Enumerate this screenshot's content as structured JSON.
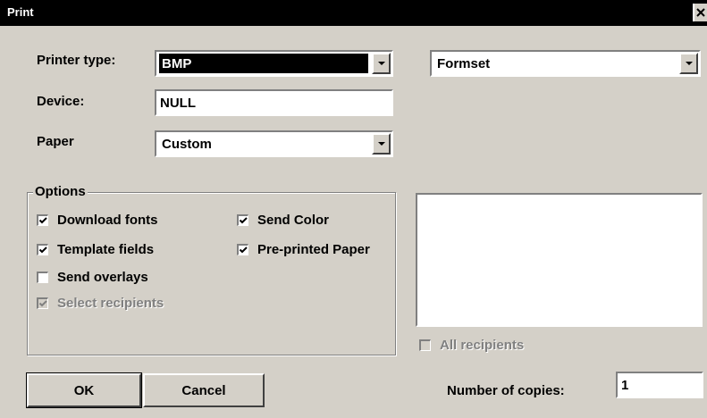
{
  "window": {
    "title": "Print"
  },
  "printer_type": {
    "label": "Printer type:",
    "value": "BMP"
  },
  "formset": {
    "value": "Formset"
  },
  "device": {
    "label": "Device:",
    "value": "NULL"
  },
  "paper": {
    "label": "Paper",
    "value": "Custom"
  },
  "options": {
    "legend": "Options",
    "download_fonts": {
      "label": "Download fonts",
      "checked": true
    },
    "send_color": {
      "label": "Send Color",
      "checked": true
    },
    "template_fields": {
      "label": "Template fields",
      "checked": true
    },
    "preprinted_paper": {
      "label": "Pre-printed Paper",
      "checked": true
    },
    "send_overlays": {
      "label": "Send overlays",
      "checked": false
    },
    "select_recipients": {
      "label": "Select recipients",
      "checked": true,
      "enabled": false
    }
  },
  "recipients": {
    "all_label": "All recipients",
    "all_checked": false,
    "enabled": false,
    "items": []
  },
  "buttons": {
    "ok": "OK",
    "cancel": "Cancel"
  },
  "copies": {
    "label": "Number of copies:",
    "value": "1"
  },
  "colors": {
    "face": "#d4d0c8",
    "titlebar": "#000000",
    "selection": "#000000",
    "disabled_text": "#808080"
  },
  "icons": {
    "close": "close-icon",
    "dropdown": "chevron-down-icon",
    "check": "checkmark-icon"
  }
}
